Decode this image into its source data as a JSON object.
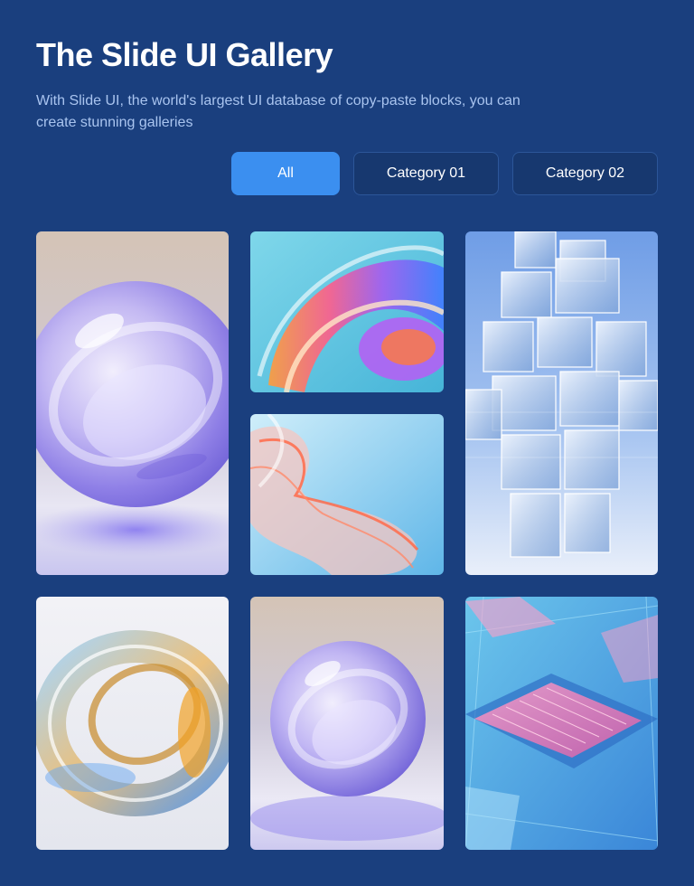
{
  "header": {
    "title": "The Slide UI Gallery",
    "subtitle": "With Slide UI, the world's largest UI database of copy-paste blocks, you can create stunning galleries"
  },
  "filters": [
    {
      "label": "All",
      "active": true
    },
    {
      "label": "Category 01",
      "active": false
    },
    {
      "label": "Category 02",
      "active": false
    }
  ],
  "gallery": {
    "images": [
      {
        "name": "glass-sphere-purple"
      },
      {
        "name": "rainbow-swirl"
      },
      {
        "name": "glass-ribbon-coral"
      },
      {
        "name": "glass-cube-tower"
      },
      {
        "name": "glass-ring-gold"
      },
      {
        "name": "glass-sphere-small"
      },
      {
        "name": "circuit-chip"
      }
    ]
  },
  "colors": {
    "background": "#1a3f7e",
    "accent": "#3b8ff0",
    "subtitle": "#a9c4ef"
  }
}
